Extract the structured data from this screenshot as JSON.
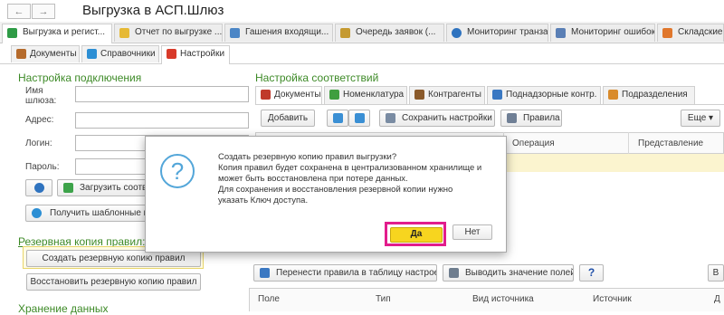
{
  "window": {
    "back_icon": "arrow-left-icon",
    "forward_icon": "arrow-right-icon",
    "back_glyph": "←",
    "forward_glyph": "→",
    "title": "Выгрузка в АСП.Шлюз"
  },
  "main_tabs": [
    {
      "label": "Выгрузка и регист...",
      "icon": "green-app-icon",
      "color": "#2e9b46",
      "active": true
    },
    {
      "label": "Отчет по выгрузке ...",
      "icon": "report-icon",
      "color": "#e6b935"
    },
    {
      "label": "Гашения входящи...",
      "icon": "registry-icon",
      "color": "#4c86c6"
    },
    {
      "label": "Очередь заявок (...",
      "icon": "queue-icon",
      "color": "#c59a31"
    },
    {
      "label": "Мониторинг транза...",
      "icon": "globe-icon",
      "color": "#2f73bf"
    },
    {
      "label": "Мониторинг ошибок",
      "icon": "monitor-icon",
      "color": "#5a7fb5"
    },
    {
      "label": "Складские",
      "icon": "warehouse-icon",
      "color": "#e0772c"
    }
  ],
  "sub_tabs": [
    {
      "label": "Документы",
      "icon": "folder-icon",
      "color": "#b56b2c"
    },
    {
      "label": "Справочники",
      "icon": "book-icon",
      "color": "#2d8fd4"
    },
    {
      "label": "Настройки",
      "icon": "settings-icon",
      "color": "#d83a2a",
      "active": true
    }
  ],
  "connection": {
    "title": "Настройка подключения",
    "name_label_1": "Имя",
    "name_label_2": "шлюза:",
    "address_label": "Адрес:",
    "login_label": "Логин:",
    "password_label": "Пароль:",
    "load_settings_button": "Загрузить соотве",
    "get_templates_button": "Получить шаблонные пр"
  },
  "backup": {
    "title": "Резервная копия правил:",
    "create_button": "Создать резервную копию правил",
    "restore_button": "Восстановить резервную копию правил"
  },
  "storage": {
    "title": "Хранение данных"
  },
  "mapping": {
    "title": "Настройка соответствий",
    "tabs": [
      {
        "label": "Документы",
        "icon": "docs-icon",
        "color": "#c0392b",
        "active": true
      },
      {
        "label": "Номенклатура",
        "icon": "nomenclature-icon",
        "color": "#3f9e3f"
      },
      {
        "label": "Контрагенты",
        "icon": "counterparties-icon",
        "color": "#8a5a2b"
      },
      {
        "label": "Поднадзорные контр.",
        "icon": "supervised-icon",
        "color": "#3a78c2"
      },
      {
        "label": "Подразделения",
        "icon": "departments-icon",
        "color": "#d98b2b"
      }
    ],
    "toolbar": {
      "add_button": "Добавить",
      "save_settings_button": "Сохранить настройки",
      "rules_button": "Правила",
      "more_button": "Еще",
      "more_caret": "▾"
    },
    "columns": [
      "Операция",
      "Представление"
    ]
  },
  "bottom_toolbar": {
    "move_rules_button": "Перенести правила в таблицу настроек",
    "show_values_button": "Выводить значение полей",
    "help_button": "?",
    "partial_button": "В"
  },
  "bottom_columns": [
    "Поле",
    "Тип",
    "Вид источника",
    "Источник",
    "Д"
  ],
  "dialog": {
    "icon": "question-icon",
    "icon_glyph": "?",
    "message_lines": [
      "Создать резервную копию правил выгрузки?",
      "Копия правил будет сохранена в централизованном хранилище и",
      "может быть восстановлена при потере данных.",
      "Для сохранения и восстановления резервной копии нужно",
      "указать Ключ доступа."
    ],
    "yes_button": "Да",
    "no_button": "Нет",
    "highlight_color": "#e21d8c"
  }
}
